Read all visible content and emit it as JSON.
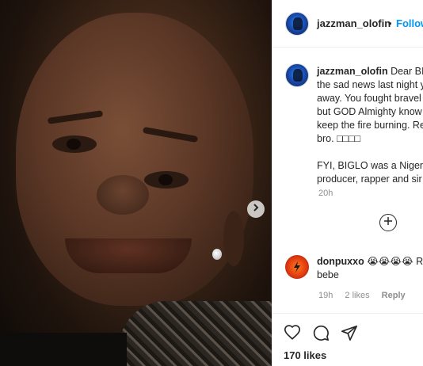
{
  "post": {
    "username": "jazzman_olofin",
    "dot": "•",
    "follow_label": "Follow",
    "caption_lines": [
      "Dear BIG",
      "the sad news last night y",
      "away. You fought bravel",
      "but GOD Almighty know",
      "keep the fire burning. Re",
      "bro. □□□□",
      "",
      "FYI, BIGLO was a Nigeria",
      "producer, rapper and sir"
    ],
    "caption_time": "20h",
    "likes": "170 likes"
  },
  "comment": {
    "username": "donpuxxo",
    "emoji": "😭😭😭😭",
    "text_line1_suffix": " R.I.",
    "text_line2": "bebe",
    "time": "19h",
    "likes": "2 likes",
    "reply_label": "Reply"
  },
  "icons": {
    "next": "chevron-right-icon",
    "load_more": "plus-circle-icon",
    "like": "heart-icon",
    "comment": "comment-icon",
    "share": "paper-plane-icon"
  },
  "colors": {
    "follow": "#0095f6",
    "muted": "#8e8e8e",
    "text": "#262626"
  }
}
